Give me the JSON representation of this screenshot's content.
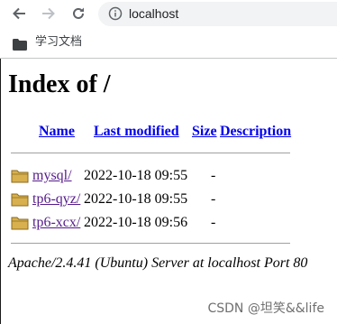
{
  "browser": {
    "url": "localhost",
    "bookmark": "学习文档",
    "icons": {
      "back": "back-arrow-icon",
      "forward": "forward-arrow-icon",
      "reload": "reload-icon",
      "info": "info-icon",
      "folder": "folder-icon"
    }
  },
  "page": {
    "title": "Index of /",
    "columns": {
      "name": "Name",
      "last_modified": "Last modified",
      "size": "Size",
      "description": "Description"
    },
    "rows": [
      {
        "name": "mysql/",
        "modified": "2022-10-18 09:55",
        "size": "-"
      },
      {
        "name": "tp6-qyz/",
        "modified": "2022-10-18 09:55",
        "size": "-"
      },
      {
        "name": "tp6-xcx/",
        "modified": "2022-10-18 09:56",
        "size": "-"
      }
    ],
    "address": "Apache/2.4.41 (Ubuntu) Server at localhost Port 80"
  },
  "watermark": "CSDN @坦笑&&life",
  "colors": {
    "link": "#0000ee",
    "visited_link": "#551a8b",
    "folder_icon": "#c9a13c"
  }
}
